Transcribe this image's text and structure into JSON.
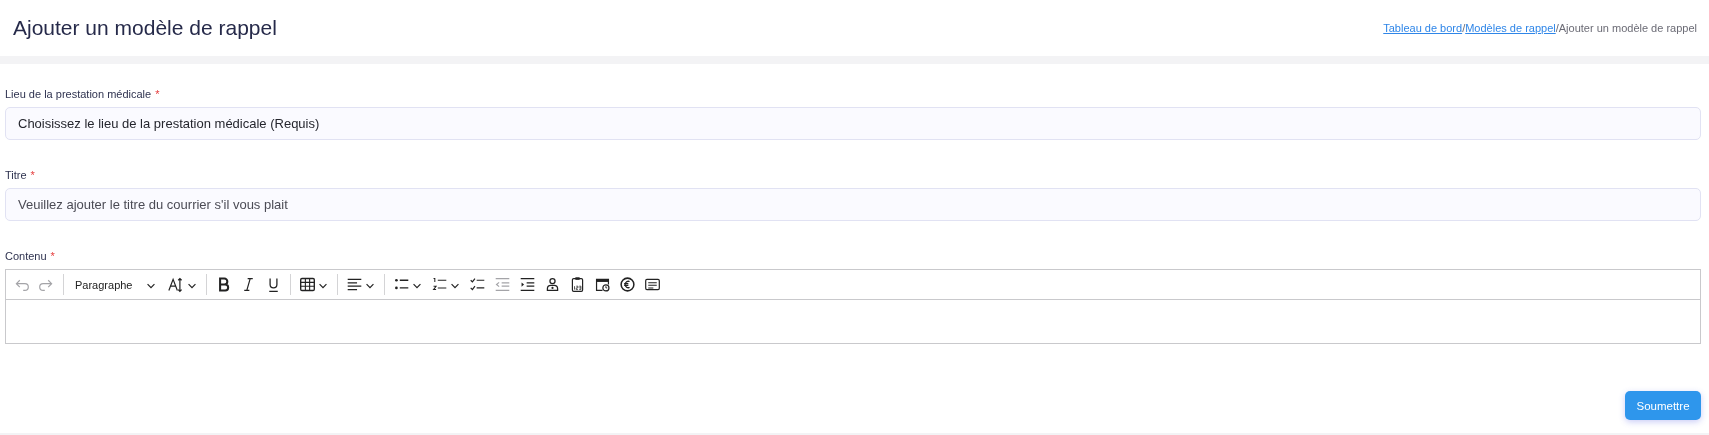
{
  "header": {
    "title": "Ajouter un modèle de rappel",
    "breadcrumb": [
      {
        "label": "Tableau de bord",
        "kind": "link"
      },
      {
        "label": "/",
        "kind": "separator"
      },
      {
        "label": "Modèles de rappel",
        "kind": "link"
      },
      {
        "label": "/",
        "kind": "separator"
      },
      {
        "label": "Ajouter un modèle de rappel",
        "kind": "current"
      }
    ]
  },
  "form": {
    "fields": [
      {
        "label": "Lieu de la prestation médicale",
        "required_mark": "*",
        "kind": "select",
        "placeholder": "Choisissez le lieu de la prestation médicale (Requis)"
      },
      {
        "label": "Titre",
        "required_mark": "*",
        "kind": "text",
        "placeholder": "Veuillez ajouter le titre du courrier s'il vous plait"
      }
    ],
    "editor": {
      "label": "Contenu",
      "required_mark": "*",
      "toolbar": [
        {
          "kind": "undo",
          "disabled": true
        },
        {
          "kind": "redo",
          "disabled": true
        },
        {
          "kind": "separator"
        },
        {
          "kind": "heading",
          "label": "Paragraphe"
        },
        {
          "kind": "font-size",
          "disabled": false
        },
        {
          "kind": "separator"
        },
        {
          "kind": "bold",
          "disabled": false
        },
        {
          "kind": "italic",
          "disabled": false
        },
        {
          "kind": "underline",
          "disabled": false
        },
        {
          "kind": "separator"
        },
        {
          "kind": "table",
          "disabled": false
        },
        {
          "kind": "separator"
        },
        {
          "kind": "align",
          "disabled": false
        },
        {
          "kind": "separator"
        },
        {
          "kind": "bullet-list",
          "disabled": false
        },
        {
          "kind": "numbered-list",
          "disabled": false
        },
        {
          "kind": "checklist",
          "disabled": false
        },
        {
          "kind": "outdent",
          "disabled": true
        },
        {
          "kind": "indent",
          "disabled": false
        },
        {
          "kind": "person",
          "disabled": false
        },
        {
          "kind": "clipboard-number",
          "disabled": false
        },
        {
          "kind": "calendar-clock",
          "disabled": false
        },
        {
          "kind": "euro",
          "disabled": false
        },
        {
          "kind": "text-box",
          "disabled": false
        }
      ]
    },
    "submit": "Soumettre"
  }
}
